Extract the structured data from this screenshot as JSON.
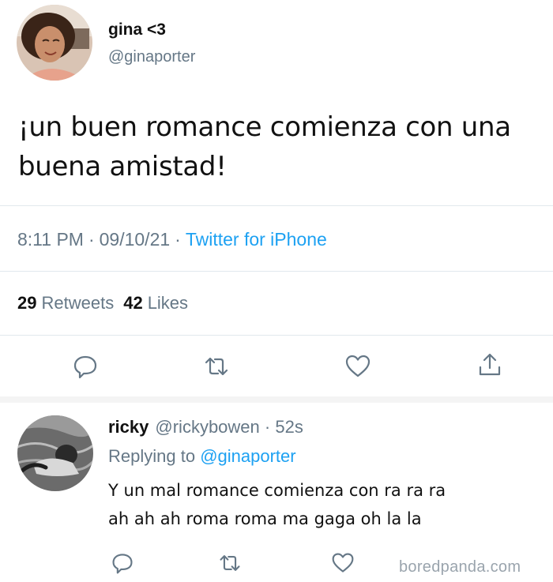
{
  "tweet": {
    "display_name": "gina <3",
    "handle": "@ginaporter",
    "text": "¡un buen romance comienza con una buena amistad!",
    "time": "8:11 PM",
    "date": "09/10/21",
    "source": "Twitter for iPhone",
    "retweets_count": "29",
    "retweets_label": "Retweets",
    "likes_count": "42",
    "likes_label": "Likes"
  },
  "reply": {
    "display_name": "ricky",
    "handle": "@rickybowen",
    "age": "52s",
    "replying_label": "Replying to",
    "replying_to": "@ginaporter",
    "text_line1": "Y un mal romance comienza con ra ra ra",
    "text_line2": "ah ah ah roma roma ma gaga oh la la"
  },
  "icons": [
    "reply-icon",
    "retweet-icon",
    "like-icon",
    "share-icon"
  ],
  "watermark": "boredpanda.com",
  "colors": {
    "link": "#1da1f2",
    "secondary_text": "#657786",
    "divider": "#e1e8ed"
  }
}
